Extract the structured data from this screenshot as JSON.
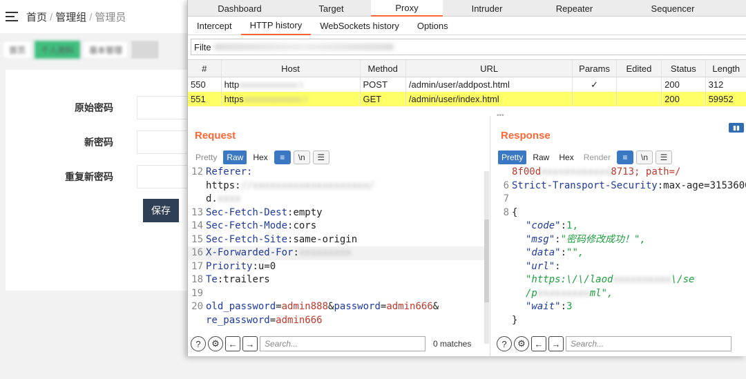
{
  "admin": {
    "breadcrumb": [
      "首页",
      "管理组",
      "管理员"
    ],
    "tabs": [
      "首页",
      "个人资料",
      "基本管理"
    ],
    "form": {
      "old_password_label": "原始密码",
      "new_password_label": "新密码",
      "repeat_password_label": "重复新密码",
      "save_label": "保存"
    }
  },
  "burp": {
    "main_tabs": [
      "Dashboard",
      "Target",
      "Proxy",
      "Intruder",
      "Repeater",
      "Sequencer"
    ],
    "proxy_tabs": [
      "Intercept",
      "HTTP history",
      "WebSockets history",
      "Options"
    ],
    "filter_label": "Filte",
    "columns": [
      "#",
      "Host",
      "Method",
      "URL",
      "Params",
      "Edited",
      "Status",
      "Length"
    ],
    "rows": [
      {
        "num": "550",
        "host": "http",
        "method": "POST",
        "url": "/admin/user/addpost.html",
        "params": "✓",
        "edited": "",
        "status": "200",
        "length": "312"
      },
      {
        "num": "551",
        "host": "https",
        "method": "GET",
        "url": "/admin/user/index.html",
        "params": "",
        "edited": "",
        "status": "200",
        "length": "59952"
      }
    ],
    "request": {
      "title": "Request",
      "view_tabs": [
        "Pretty",
        "Raw",
        "Hex"
      ],
      "lines": {
        "l12": "Referer:",
        "l12b": "https:",
        "l12c": "d.",
        "l13k": "Sec-Fetch-Dest",
        "l13v": "empty",
        "l14k": "Sec-Fetch-Mode",
        "l14v": "cors",
        "l15k": "Sec-Fetch-Site",
        "l15v": "same-origin",
        "l16k": "X-Forwarded-For",
        "l17k": "Priority",
        "l17v": "u=0",
        "l18k": "Te",
        "l18v": "trailers",
        "l20a": "old_password",
        "l20b": "admin888",
        "l20c": "password",
        "l20d": "admin666",
        "l20e": "re_password",
        "l20f": "admin666"
      }
    },
    "response": {
      "title": "Response",
      "view_tabs": [
        "Pretty",
        "Raw",
        "Hex",
        "Render"
      ],
      "lines": {
        "l5a": "8f00d",
        "l5b": "8713; path=/",
        "l6k": "Strict-Transport-Security",
        "l6v": "max-age=3153600",
        "l8": "{",
        "code_k": "\"code\"",
        "code_v": "1,",
        "msg_k": "\"msg\"",
        "msg_v": "\"密码修改成功！\",",
        "data_k": "\"data\"",
        "data_v": "\"\",",
        "url_k": "\"url\"",
        "url_v1": "\"https:\\/\\/laod",
        "url_v1b": "\\/se",
        "url_v2": "/p",
        "url_v2b": "ml\",",
        "wait_k": "\"wait\"",
        "wait_v": "3",
        "close": "}"
      }
    },
    "search_placeholder": "Search...",
    "matches": "0 matches"
  }
}
